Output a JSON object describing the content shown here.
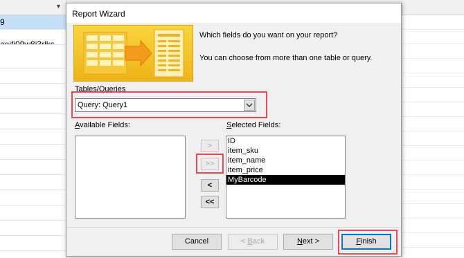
{
  "background": {
    "rows": [
      {
        "text": "9",
        "selected": true
      },
      {
        "text": "aeifj09w8j3rlks",
        "selected": false
      }
    ]
  },
  "dialog": {
    "title": "Report Wizard",
    "intro_question": "Which fields do you want on your report?",
    "intro_hint": "You can choose from more than one table or query.",
    "tables_label": {
      "underlined": "T",
      "rest": "ables/Queries"
    },
    "tables_value": "Query: Query1",
    "available_label": {
      "underlined": "A",
      "rest": "vailable Fields:"
    },
    "selected_label": {
      "underlined": "S",
      "rest": "elected Fields:"
    },
    "available_fields": [],
    "selected_fields": [
      "ID",
      "item_sku",
      "item_name",
      "item_price",
      "MyBarcode"
    ],
    "selected_field_active": "MyBarcode",
    "move_buttons": {
      "add_one": ">",
      "add_all": ">>",
      "remove_one": "<",
      "remove_all": "<<"
    },
    "buttons": {
      "cancel": "Cancel",
      "back": {
        "prefix": "< ",
        "underlined": "B",
        "rest": "ack"
      },
      "next": {
        "underlined": "N",
        "rest": "ext >"
      },
      "finish": {
        "underlined": "F",
        "rest": "inish"
      }
    },
    "highlight_color": "#e84a55",
    "banner_color": "#f4c430"
  }
}
